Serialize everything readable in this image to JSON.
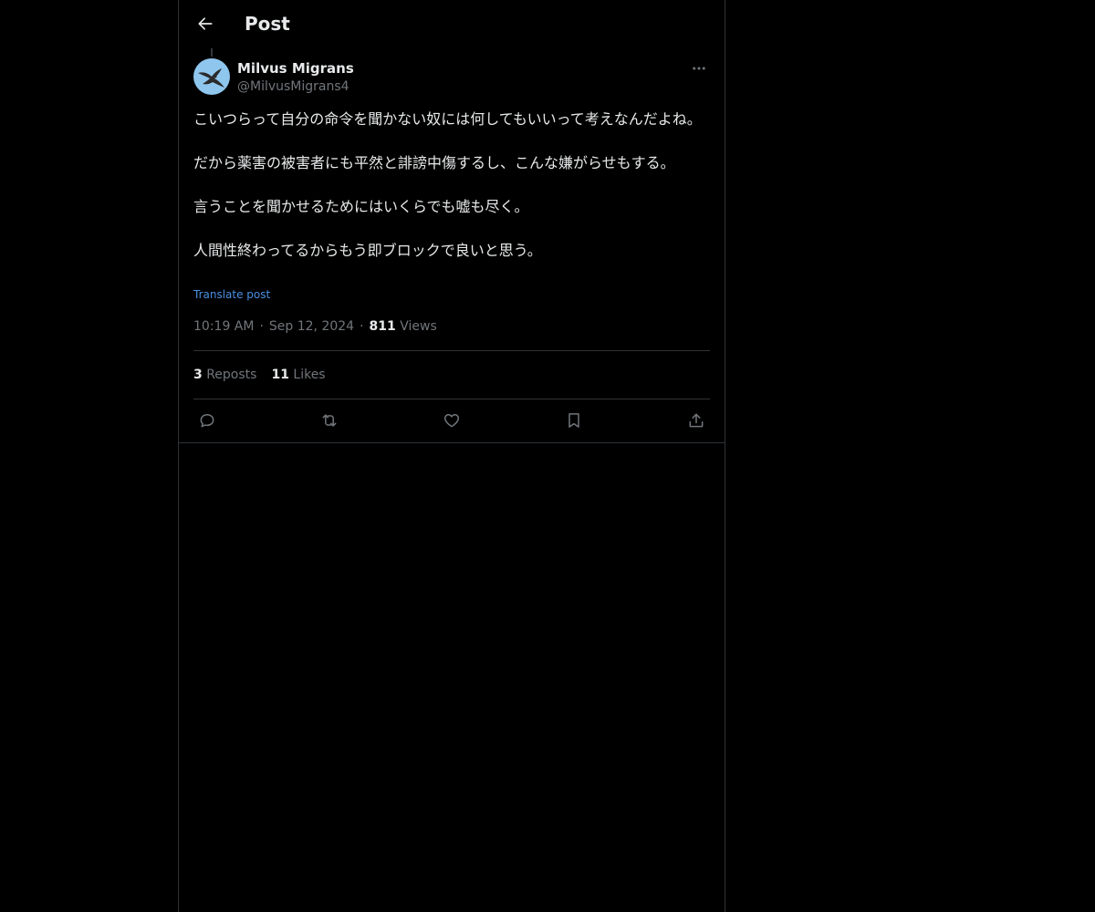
{
  "header": {
    "title": "Post",
    "back_icon": "arrow-left-icon"
  },
  "post": {
    "author": {
      "display_name": "Milvus Migrans",
      "handle": "@MilvusMigrans4",
      "avatar_icon": "kite-bird-avatar"
    },
    "more_icon": "more-horizontal-icon",
    "text": "こいつらって自分の命令を聞かない奴には何してもいいって考えなんだよね。\n\nだから薬害の被害者にも平然と誹謗中傷するし、こんな嫌がらせもする。\n\n言うことを聞かせるためにはいくらでも嘘も尽く。\n\n人間性終わってるからもう即ブロックで良いと思う。",
    "translate_label": "Translate post",
    "time": "10:19 AM",
    "separator": "·",
    "date": "Sep 12, 2024",
    "views_count": "811",
    "views_label": "Views"
  },
  "stats": {
    "reposts_count": "3",
    "reposts_label": "Reposts",
    "likes_count": "11",
    "likes_label": "Likes"
  },
  "actions": [
    {
      "name": "reply",
      "icon": "reply-icon"
    },
    {
      "name": "repost",
      "icon": "repost-icon"
    },
    {
      "name": "like",
      "icon": "heart-icon"
    },
    {
      "name": "bookmark",
      "icon": "bookmark-icon"
    },
    {
      "name": "share",
      "icon": "share-icon"
    }
  ],
  "colors": {
    "background": "#000000",
    "text_primary": "#e7e9ea",
    "text_secondary": "#71767b",
    "link": "#4a90e2",
    "border": "#2f3336"
  }
}
